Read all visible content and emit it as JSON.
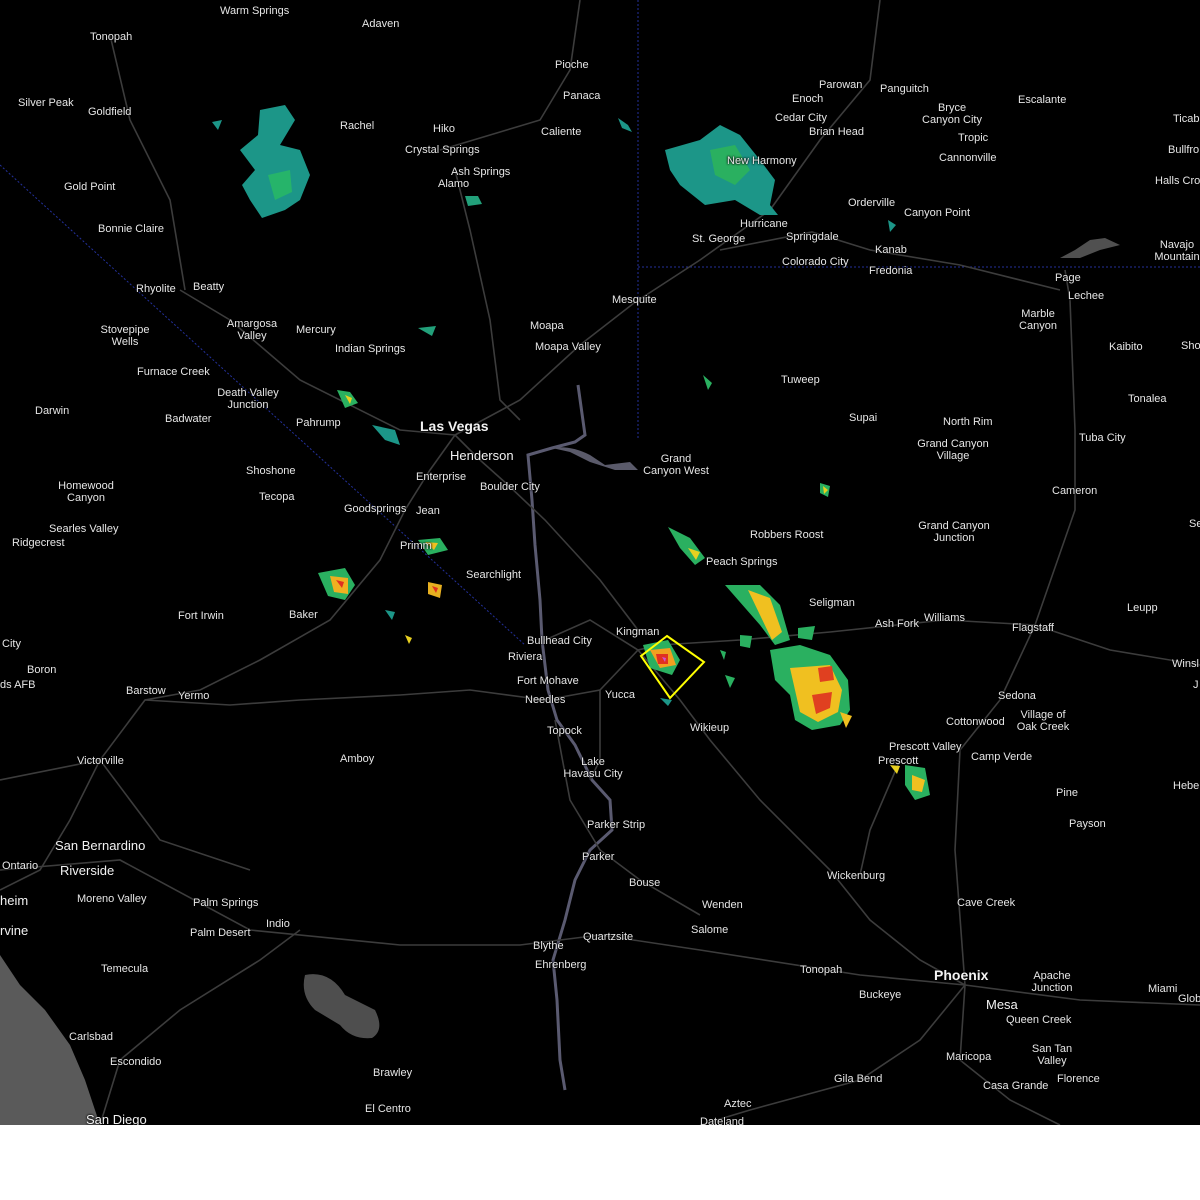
{
  "map": {
    "cities": [
      {
        "name": "Warm Springs",
        "size": "sm"
      },
      {
        "name": "Adaven",
        "size": "sm"
      },
      {
        "name": "Tonopah",
        "size": "sm"
      },
      {
        "name": "Pioche",
        "size": "sm"
      },
      {
        "name": "Panaca",
        "size": "sm"
      },
      {
        "name": "Silver Peak",
        "size": "sm"
      },
      {
        "name": "Goldfield",
        "size": "sm"
      },
      {
        "name": "Rachel",
        "size": "sm"
      },
      {
        "name": "Hiko",
        "size": "sm"
      },
      {
        "name": "Caliente",
        "size": "sm"
      },
      {
        "name": "Crystal Springs",
        "size": "sm"
      },
      {
        "name": "Ash Springs",
        "size": "sm"
      },
      {
        "name": "Alamo",
        "size": "sm"
      },
      {
        "name": "Gold Point",
        "size": "sm"
      },
      {
        "name": "Bonnie Claire",
        "size": "sm"
      },
      {
        "name": "Rhyolite",
        "size": "sm"
      },
      {
        "name": "Beatty",
        "size": "sm"
      },
      {
        "name": "Amargosa Valley",
        "size": "sm"
      },
      {
        "name": "Mercury",
        "size": "sm"
      },
      {
        "name": "Indian Springs",
        "size": "sm"
      },
      {
        "name": "Stovepipe Wells",
        "size": "sm"
      },
      {
        "name": "Furnace Creek",
        "size": "sm"
      },
      {
        "name": "Death Valley Junction",
        "size": "sm"
      },
      {
        "name": "Darwin",
        "size": "sm"
      },
      {
        "name": "Badwater",
        "size": "sm"
      },
      {
        "name": "Pahrump",
        "size": "sm"
      },
      {
        "name": "Las Vegas",
        "size": "big"
      },
      {
        "name": "Henderson",
        "size": "med"
      },
      {
        "name": "Enterprise",
        "size": "sm"
      },
      {
        "name": "Boulder City",
        "size": "sm"
      },
      {
        "name": "Shoshone",
        "size": "sm"
      },
      {
        "name": "Tecopa",
        "size": "sm"
      },
      {
        "name": "Homewood Canyon",
        "size": "sm"
      },
      {
        "name": "Searles Valley",
        "size": "sm"
      },
      {
        "name": "Ridgecrest",
        "size": "sm"
      },
      {
        "name": "Goodsprings",
        "size": "sm"
      },
      {
        "name": "Jean",
        "size": "sm"
      },
      {
        "name": "Primm",
        "size": "sm"
      },
      {
        "name": "Searchlight",
        "size": "sm"
      },
      {
        "name": "Fort Irwin",
        "size": "sm"
      },
      {
        "name": "Baker",
        "size": "sm"
      },
      {
        "name": "City",
        "size": "sm"
      },
      {
        "name": "Boron",
        "size": "sm"
      },
      {
        "name": "ds AFB",
        "size": "sm"
      },
      {
        "name": "Barstow",
        "size": "sm"
      },
      {
        "name": "Yermo",
        "size": "sm"
      },
      {
        "name": "Bullhead City",
        "size": "sm"
      },
      {
        "name": "Riviera",
        "size": "sm"
      },
      {
        "name": "Fort Mohave",
        "size": "sm"
      },
      {
        "name": "Needles",
        "size": "sm"
      },
      {
        "name": "Kingman",
        "size": "sm"
      },
      {
        "name": "Yucca",
        "size": "sm"
      },
      {
        "name": "Topock",
        "size": "sm"
      },
      {
        "name": "Wikieup",
        "size": "sm"
      },
      {
        "name": "Victorville",
        "size": "sm"
      },
      {
        "name": "Amboy",
        "size": "sm"
      },
      {
        "name": "Lake Havasu City",
        "size": "sm"
      },
      {
        "name": "Parker Strip",
        "size": "sm"
      },
      {
        "name": "Parker",
        "size": "sm"
      },
      {
        "name": "San Bernardino",
        "size": "med"
      },
      {
        "name": "Ontario",
        "size": "sm"
      },
      {
        "name": "Riverside",
        "size": "med"
      },
      {
        "name": "Moreno Valley",
        "size": "sm"
      },
      {
        "name": "Palm Springs",
        "size": "sm"
      },
      {
        "name": "Indio",
        "size": "sm"
      },
      {
        "name": "Palm Desert",
        "size": "sm"
      },
      {
        "name": "heim",
        "size": "med"
      },
      {
        "name": "rvine",
        "size": "med"
      },
      {
        "name": "Temecula",
        "size": "sm"
      },
      {
        "name": "Bouse",
        "size": "sm"
      },
      {
        "name": "Wenden",
        "size": "sm"
      },
      {
        "name": "Salome",
        "size": "sm"
      },
      {
        "name": "Blythe",
        "size": "sm"
      },
      {
        "name": "Ehrenberg",
        "size": "sm"
      },
      {
        "name": "Quartzsite",
        "size": "sm"
      },
      {
        "name": "Carlsbad",
        "size": "sm"
      },
      {
        "name": "Escondido",
        "size": "sm"
      },
      {
        "name": "San Diego",
        "size": "med"
      },
      {
        "name": "Brawley",
        "size": "sm"
      },
      {
        "name": "El Centro",
        "size": "sm"
      },
      {
        "name": "Aztec",
        "size": "sm"
      },
      {
        "name": "Dateland",
        "size": "sm"
      },
      {
        "name": "Parowan",
        "size": "sm"
      },
      {
        "name": "Enoch",
        "size": "sm"
      },
      {
        "name": "Panguitch",
        "size": "sm"
      },
      {
        "name": "Cedar City",
        "size": "sm"
      },
      {
        "name": "Brian Head",
        "size": "sm"
      },
      {
        "name": "Bryce Canyon City",
        "size": "sm"
      },
      {
        "name": "Tropic",
        "size": "sm"
      },
      {
        "name": "Escalante",
        "size": "sm"
      },
      {
        "name": "Cannonville",
        "size": "sm"
      },
      {
        "name": "Ticab",
        "size": "sm"
      },
      {
        "name": "Bullfro",
        "size": "sm"
      },
      {
        "name": "Halls Cros",
        "size": "sm"
      },
      {
        "name": "New Harmony",
        "size": "sm"
      },
      {
        "name": "Orderville",
        "size": "sm"
      },
      {
        "name": "Canyon Point",
        "size": "sm"
      },
      {
        "name": "Hurricane",
        "size": "sm"
      },
      {
        "name": "St. George",
        "size": "sm"
      },
      {
        "name": "Springdale",
        "size": "sm"
      },
      {
        "name": "Kanab",
        "size": "sm"
      },
      {
        "name": "Colorado City",
        "size": "sm"
      },
      {
        "name": "Fredonia",
        "size": "sm"
      },
      {
        "name": "Navajo Mountain",
        "size": "sm"
      },
      {
        "name": "Page",
        "size": "sm"
      },
      {
        "name": "Lechee",
        "size": "sm"
      },
      {
        "name": "Mesquite",
        "size": "sm"
      },
      {
        "name": "Moapa",
        "size": "sm"
      },
      {
        "name": "Moapa Valley",
        "size": "sm"
      },
      {
        "name": "Marble Canyon",
        "size": "sm"
      },
      {
        "name": "Kaibito",
        "size": "sm"
      },
      {
        "name": "Sho",
        "size": "sm"
      },
      {
        "name": "Tuweep",
        "size": "sm"
      },
      {
        "name": "Supai",
        "size": "sm"
      },
      {
        "name": "North Rim",
        "size": "sm"
      },
      {
        "name": "Tonalea",
        "size": "sm"
      },
      {
        "name": "Grand Canyon Village",
        "size": "sm"
      },
      {
        "name": "Tuba City",
        "size": "sm"
      },
      {
        "name": "Grand Canyon West",
        "size": "sm"
      },
      {
        "name": "Cameron",
        "size": "sm"
      },
      {
        "name": "Robbers Roost",
        "size": "sm"
      },
      {
        "name": "Grand Canyon Junction",
        "size": "sm"
      },
      {
        "name": "Se",
        "size": "sm"
      },
      {
        "name": "Peach Springs",
        "size": "sm"
      },
      {
        "name": "Seligman",
        "size": "sm"
      },
      {
        "name": "Ash Fork",
        "size": "sm"
      },
      {
        "name": "Williams",
        "size": "sm"
      },
      {
        "name": "Flagstaff",
        "size": "sm"
      },
      {
        "name": "Leupp",
        "size": "sm"
      },
      {
        "name": "Winsl",
        "size": "sm"
      },
      {
        "name": "J",
        "size": "sm"
      },
      {
        "name": "Sedona",
        "size": "sm"
      },
      {
        "name": "Village of Oak Creek",
        "size": "sm"
      },
      {
        "name": "Cottonwood",
        "size": "sm"
      },
      {
        "name": "Prescott Valley",
        "size": "sm"
      },
      {
        "name": "Prescott",
        "size": "sm"
      },
      {
        "name": "Camp Verde",
        "size": "sm"
      },
      {
        "name": "Hebe",
        "size": "sm"
      },
      {
        "name": "Pine",
        "size": "sm"
      },
      {
        "name": "Payson",
        "size": "sm"
      },
      {
        "name": "Wickenburg",
        "size": "sm"
      },
      {
        "name": "Cave Creek",
        "size": "sm"
      },
      {
        "name": "Tonopah",
        "size": "sm"
      },
      {
        "name": "Buckeye",
        "size": "sm"
      },
      {
        "name": "Phoenix",
        "size": "big"
      },
      {
        "name": "Apache Junction",
        "size": "sm"
      },
      {
        "name": "Mesa",
        "size": "med"
      },
      {
        "name": "Miami",
        "size": "sm"
      },
      {
        "name": "Glob",
        "size": "sm"
      },
      {
        "name": "Queen Creek",
        "size": "sm"
      },
      {
        "name": "San Tan Valley",
        "size": "sm"
      },
      {
        "name": "Maricopa",
        "size": "sm"
      },
      {
        "name": "Florence",
        "size": "sm"
      },
      {
        "name": "Gila Bend",
        "size": "sm"
      },
      {
        "name": "Casa Grande",
        "size": "sm"
      }
    ],
    "colors": {
      "background": "#000000",
      "roads": "#3a3a3a",
      "state_border": "#1f2a9a",
      "water": "#5b5b5b",
      "warning_polygon": "#ffff00",
      "radar_light": "#1a9a8a",
      "radar_mid": "#2ad44a",
      "radar_high": "#f5e020",
      "radar_severe": "#e03020"
    }
  }
}
